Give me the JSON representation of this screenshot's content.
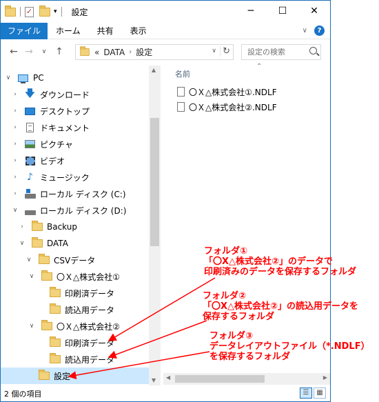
{
  "window": {
    "title": "設定"
  },
  "ribbon": {
    "tabs": [
      "ファイル",
      "ホーム",
      "共有",
      "表示"
    ]
  },
  "address": {
    "prefix": "«",
    "crumbs": [
      "DATA",
      "設定"
    ]
  },
  "search": {
    "placeholder": "設定の検索"
  },
  "tree": [
    {
      "label": "PC",
      "icon": "pc-icon",
      "expanded": true
    },
    {
      "label": "ダウンロード",
      "icon": "download-icon"
    },
    {
      "label": "デスクトップ",
      "icon": "desktop-icon"
    },
    {
      "label": "ドキュメント",
      "icon": "documents-icon"
    },
    {
      "label": "ピクチャ",
      "icon": "pictures-icon"
    },
    {
      "label": "ビデオ",
      "icon": "videos-icon"
    },
    {
      "label": "ミュージック",
      "icon": "music-icon"
    },
    {
      "label": "ローカル ディスク (C:)",
      "icon": "drive-c-icon"
    },
    {
      "label": "ローカル ディスク (D:)",
      "icon": "drive-d-icon",
      "expanded": true
    },
    {
      "label": "Backup",
      "icon": "folder-icon"
    },
    {
      "label": "DATA",
      "icon": "folder-icon",
      "expanded": true
    },
    {
      "label": "CSVデータ",
      "icon": "folder-icon",
      "expanded": true
    },
    {
      "label": "〇Ｘ△株式会社①",
      "icon": "folder-icon",
      "expanded": true
    },
    {
      "label": "印刷済データ",
      "icon": "folder-icon"
    },
    {
      "label": "読込用データ",
      "icon": "folder-icon"
    },
    {
      "label": "〇Ｘ△株式会社②",
      "icon": "folder-icon",
      "expanded": true
    },
    {
      "label": "印刷済データ",
      "icon": "folder-icon"
    },
    {
      "label": "読込用データ",
      "icon": "folder-icon"
    },
    {
      "label": "設定",
      "icon": "folder-icon",
      "selected": true
    }
  ],
  "content": {
    "column_header": "名前",
    "files": [
      "〇Ｘ△株式会社①.NDLF",
      "〇Ｘ△株式会社②.NDLF"
    ]
  },
  "status": {
    "item_count": "2 個の項目"
  },
  "annotations": [
    {
      "lines": [
        "フォルダ①",
        "「〇X△株式会社②」のデータで",
        "印刷済みのデータを保存するフォルダ"
      ]
    },
    {
      "lines": [
        "フォルダ②",
        "「〇X△株式会社②」の読込用データを",
        "保存するフォルダ"
      ]
    },
    {
      "lines": [
        "フォルダ③",
        "データレイアウトファイル（*.NDLF）",
        "を保存するフォルダ"
      ]
    }
  ],
  "colors": {
    "accent": "#1979ca",
    "annotation": "#ff0000",
    "selection": "#cce8ff"
  }
}
